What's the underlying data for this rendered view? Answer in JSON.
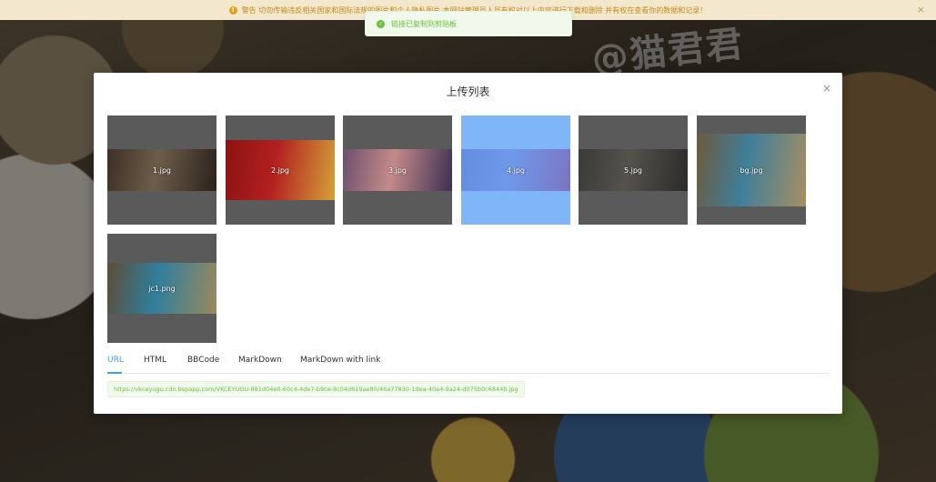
{
  "background": {
    "watermark": "@猫君君"
  },
  "warning": {
    "icon": "warning-icon",
    "text": "警告 切勿传输违反相关国家和国际法规的图片和个人隐私图片 本网站管理员人员有权对以上内容进行下载和删除 并有权在查看你的数据和记录！"
  },
  "toast": {
    "icon": "check-circle-icon",
    "message": "链接已复制到剪贴板"
  },
  "dialog": {
    "title": "上传列表",
    "close_icon": "close-icon",
    "close_glyph": "×"
  },
  "images": [
    {
      "name": "1.jpg",
      "selected": false,
      "colors": [
        "#3d2f24",
        "#6e5d4b",
        "#2a221c"
      ]
    },
    {
      "name": "2.jpg",
      "selected": false,
      "colors": [
        "#8c1212",
        "#b32020",
        "#d4a23a"
      ]
    },
    {
      "name": "3.jpg",
      "selected": false,
      "colors": [
        "#6b4f6e",
        "#c48a8a",
        "#3c2f52"
      ]
    },
    {
      "name": "4.jpg",
      "selected": true,
      "colors": [
        "#5b7fd6",
        "#6a8fe6",
        "#7b5fb0"
      ]
    },
    {
      "name": "5.jpg",
      "selected": false,
      "colors": [
        "#3a3a38",
        "#55524c",
        "#2b2b29"
      ]
    },
    {
      "name": "bg.jpg",
      "selected": false,
      "colors": [
        "#6d5a3c",
        "#3f7f9a",
        "#a88f62"
      ]
    },
    {
      "name": "jc1.png",
      "selected": false,
      "colors": [
        "#5d4d36",
        "#2f7f9c",
        "#9a8a5c"
      ]
    }
  ],
  "tabs": [
    {
      "label": "URL",
      "active": true
    },
    {
      "label": "HTML",
      "active": false
    },
    {
      "label": "BBCode",
      "active": false
    },
    {
      "label": "MarkDown",
      "active": false
    },
    {
      "label": "MarkDown with link",
      "active": false
    }
  ],
  "link": "https://vkceyugu.cdn.bspapp.com/VKCEYUGU-981d04e0-60c4-4de7-b9ce-9c04d619ae80/46a77830-1dea-40a4-9a24-d075b0c6844b.jpg",
  "colors": {
    "accent": "#409eff",
    "success": "#67c23a",
    "warning": "#e69d1a"
  }
}
